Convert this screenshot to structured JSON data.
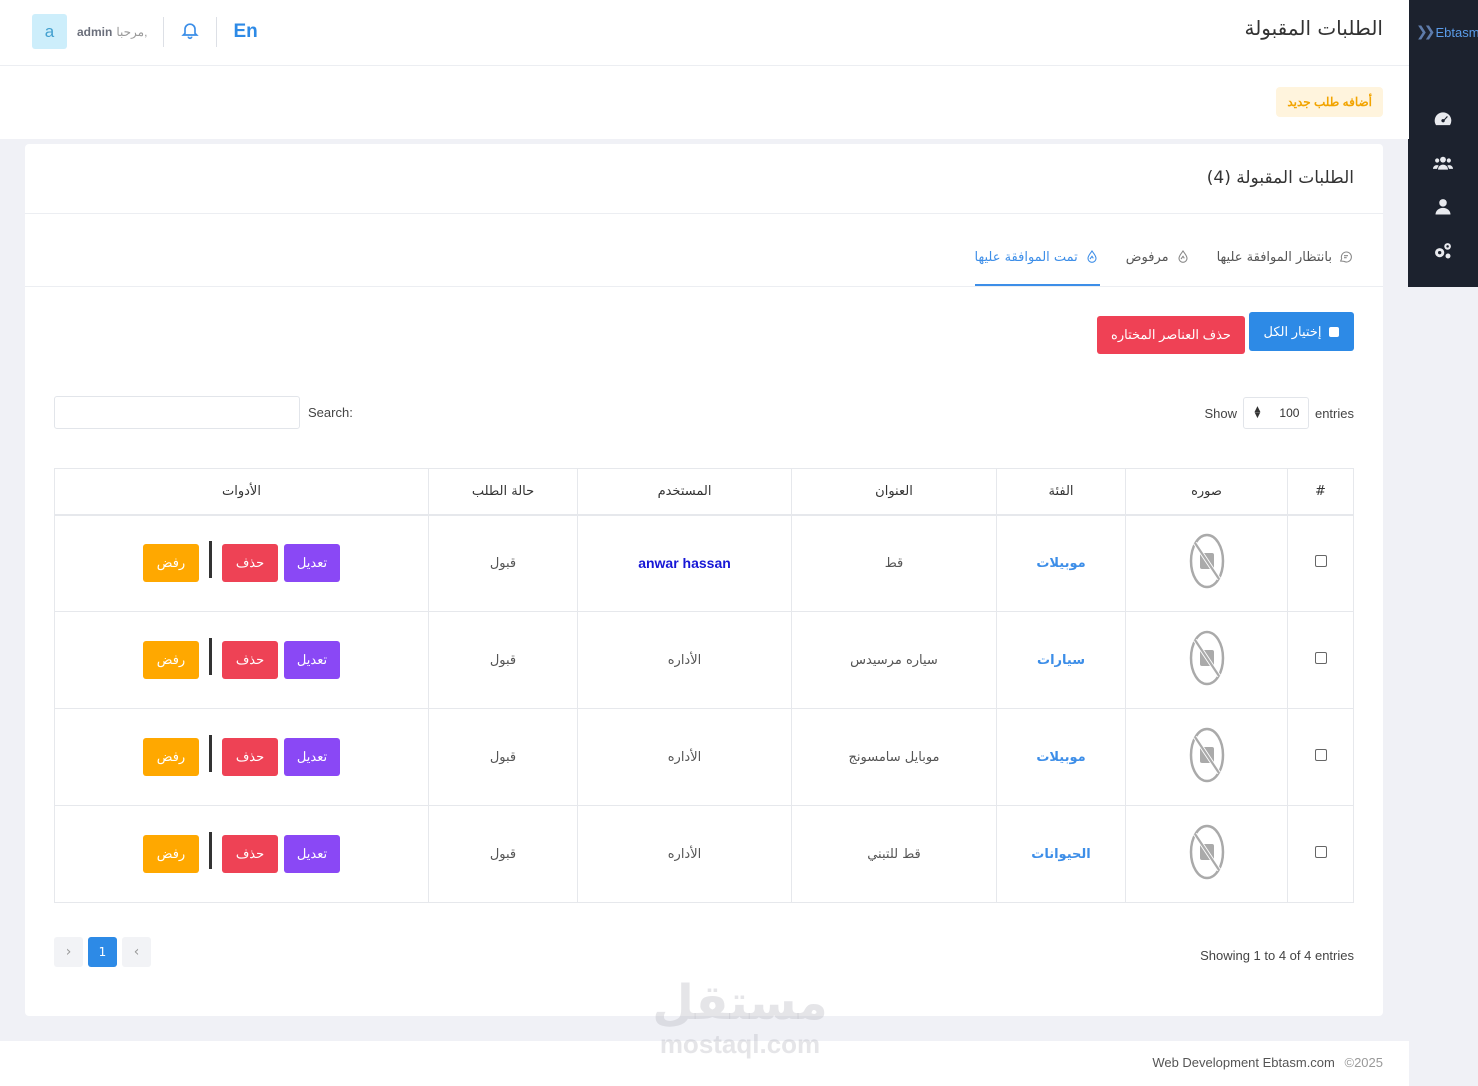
{
  "sidebar": {
    "brand": "Ebtasm",
    "items": [
      {
        "icon": "dashboard-icon"
      },
      {
        "icon": "users-icon"
      },
      {
        "icon": "user-icon"
      },
      {
        "icon": "settings-icon"
      }
    ]
  },
  "header": {
    "title": "الطلبات المقبولة",
    "avatar_letter": "a",
    "greeting": "مرحبا,",
    "username": "admin",
    "lang": "En"
  },
  "subbar": {
    "add_label": "أضافه طلب جديد"
  },
  "card": {
    "title": "الطلبات المقبولة (4)",
    "tabs": [
      {
        "label": "بانتظار الموافقة عليها",
        "icon": "chat-icon",
        "active": false
      },
      {
        "label": "مرفوض",
        "icon": "drop-icon",
        "active": false
      },
      {
        "label": "تمت الموافقة عليها",
        "icon": "drop-icon",
        "active": true
      }
    ],
    "select_all_label": "إختيار الكل",
    "delete_selected_label": "حذف العناصر المختاره",
    "entries": {
      "show": "Show",
      "value": "100",
      "suffix": "entries"
    },
    "search_label": "Search:",
    "table": {
      "headers": [
        "#",
        "صوره",
        "الفئة",
        "العنوان",
        "المستخدم",
        "حالة الطلب",
        "الأدوات"
      ],
      "rows": [
        {
          "category": "موبيلات",
          "title": "قط",
          "user": "anwar hassan",
          "status": "قبول"
        },
        {
          "category": "سيارات",
          "title": "سياره مرسيدس",
          "user": "الأداره",
          "status": "قبول"
        },
        {
          "category": "موبيلات",
          "title": "موبايل سامسونج",
          "user": "الأداره",
          "status": "قبول"
        },
        {
          "category": "الحيوانات",
          "title": "قط للتبني",
          "user": "الأداره",
          "status": "قبول"
        }
      ],
      "actions": {
        "edit": "تعديل",
        "delete": "حذف",
        "reject": "رفض"
      }
    },
    "info": "Showing 1 to 4 of 4 entries",
    "pagination": {
      "prev": "‹",
      "current": "1",
      "next": "›"
    }
  },
  "footer": {
    "year": "©2025",
    "text": "Web Development Ebtasm.com"
  },
  "watermark": {
    "ar": "مستقل",
    "en": "mostaql.com"
  }
}
